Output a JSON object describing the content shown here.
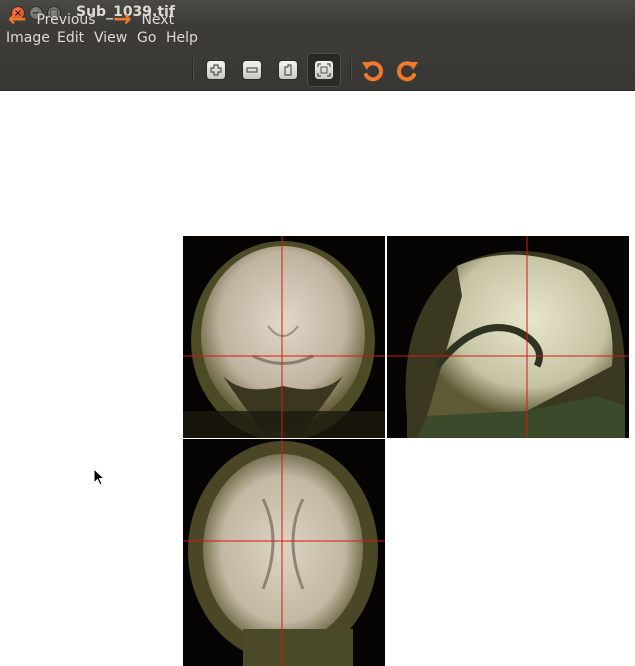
{
  "window": {
    "title": "Sub_1039.tif",
    "close_glyph": "×",
    "min_glyph": "−",
    "max_glyph": "□"
  },
  "menubar": {
    "items": [
      "Image",
      "Edit",
      "View",
      "Go",
      "Help"
    ]
  },
  "toolbar": {
    "previous_label": "Previous",
    "next_label": "Next",
    "previous_icon": "←",
    "next_icon": "→",
    "icons": [
      "zoom-in-icon",
      "zoom-out-icon",
      "normal-size-icon",
      "best-fit-icon",
      "rotate-left-icon",
      "rotate-right-icon"
    ],
    "active_tool": "best-fit-icon",
    "accent_color": "#f07a2c"
  },
  "image": {
    "views": [
      "coronal",
      "sagittal",
      "axial"
    ],
    "crosshair_color": "#d41a10"
  }
}
